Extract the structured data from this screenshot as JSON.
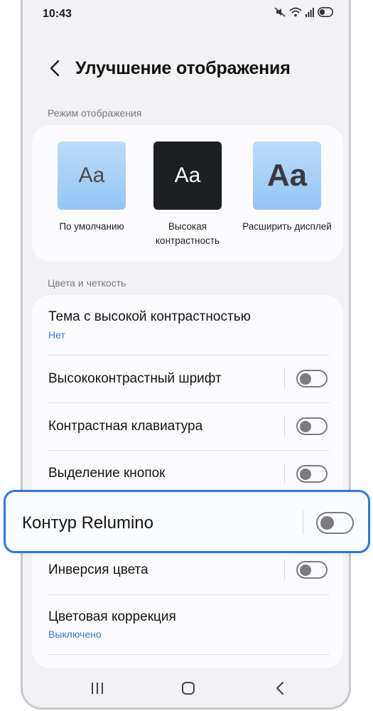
{
  "status": {
    "time": "10:43"
  },
  "header": {
    "title": "Улучшение отображения"
  },
  "display_mode": {
    "label": "Режим отображения",
    "options": [
      {
        "glyph": "Aa",
        "label": "По умолчанию"
      },
      {
        "glyph": "Aa",
        "label": "Высокая контрастность"
      },
      {
        "glyph": "Aa",
        "label": "Расширить дисплей"
      }
    ]
  },
  "colors": {
    "label": "Цвета и четкость",
    "items": [
      {
        "title": "Тема с высокой контрастностью",
        "subtitle": "Нет"
      },
      {
        "title": "Высококонтрастный шрифт",
        "toggle": false
      },
      {
        "title": "Контрастная клавиатура",
        "toggle": false
      },
      {
        "title": "Выделение кнопок",
        "toggle": false
      },
      {
        "title": "Контур Relumino",
        "toggle": false
      },
      {
        "title": "Инверсия цвета",
        "toggle": false
      },
      {
        "title": "Цветовая коррекция",
        "subtitle": "Выключено"
      }
    ]
  },
  "theme": {
    "accent": "#2e7bd6",
    "link": "#3478c6",
    "background": "#f2f2f4"
  }
}
